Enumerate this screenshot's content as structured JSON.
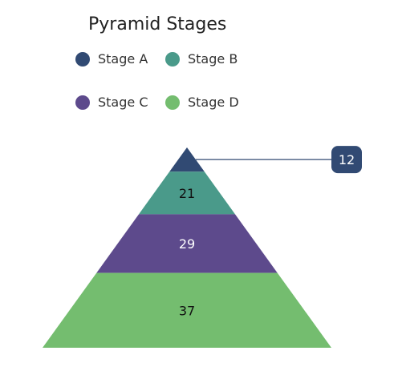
{
  "chart_data": {
    "type": "funnel",
    "title": "Pyramid Stages",
    "categories": [
      "Stage A",
      "Stage B",
      "Stage C",
      "Stage D"
    ],
    "values": [
      12,
      21,
      29,
      37
    ],
    "colors": [
      "#314a73",
      "#4a9a8a",
      "#5d4a8c",
      "#74bd6f"
    ],
    "label_text_colors": [
      "#ffffff",
      "#111111",
      "#ffffff",
      "#111111"
    ],
    "legend_position": "top",
    "label_modes": [
      "callout",
      "inside",
      "inside",
      "inside"
    ]
  }
}
